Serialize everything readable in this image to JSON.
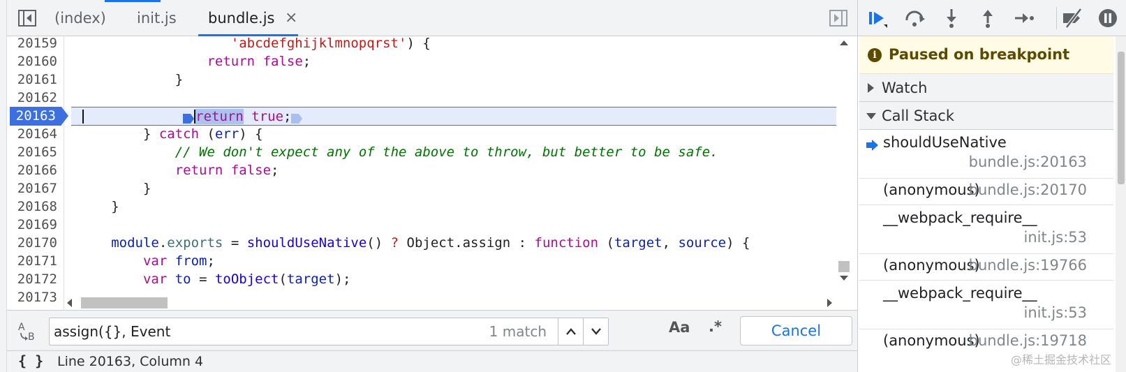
{
  "tabs": [
    {
      "label": "(index)"
    },
    {
      "label": "init.js"
    },
    {
      "label": "bundle.js",
      "close": "×"
    }
  ],
  "editor": {
    "lines": [
      {
        "num": "20159"
      },
      {
        "num": "20160"
      },
      {
        "num": "20161"
      },
      {
        "num": "20162"
      },
      {
        "num": "20163"
      },
      {
        "num": "20164"
      },
      {
        "num": "20165"
      },
      {
        "num": "20166"
      },
      {
        "num": "20167"
      },
      {
        "num": "20168"
      },
      {
        "num": "20169"
      },
      {
        "num": "20170"
      },
      {
        "num": "20171"
      },
      {
        "num": "20172"
      },
      {
        "num": "20173"
      }
    ],
    "code": {
      "l20159": {
        "str": "'abcdefghijklmnopqrst'",
        "rest": ") {"
      },
      "l20160": {
        "kw": "return",
        "val": "false",
        "semi": ";"
      },
      "l20161": {
        "brace": "}"
      },
      "l20163": {
        "kw": "return",
        "val": "true",
        "semi": ";"
      },
      "l20164": {
        "brace": "}",
        "kw": "catch",
        "open": " (",
        "var": "err",
        "close": ") {"
      },
      "l20165": {
        "comment": "// We don't expect any of the above to throw, but better to be safe."
      },
      "l20166": {
        "kw": "return",
        "val": "false",
        "semi": ";"
      },
      "l20167": {
        "brace": "}"
      },
      "l20168": {
        "brace": "}"
      },
      "l20170": {
        "obj": "module",
        "dot": ".",
        "prop": "exports",
        "eq": " = ",
        "fn": "shouldUseNative",
        "call": "() ",
        "q": "?",
        "mid": " Object.assign : ",
        "kw": "function",
        "args_open": " (",
        "a1": "target",
        "comma": ", ",
        "a2": "source",
        "args_close": ") {"
      },
      "l20171": {
        "kw": "var",
        "name": "from",
        "semi": ";"
      },
      "l20172": {
        "kw": "var",
        "name": "to",
        "eq": " = ",
        "fn": "toObject",
        "open": "(",
        "arg": "target",
        "close": ");"
      }
    }
  },
  "search": {
    "value": "assign({}, Event",
    "match_count": "1 match",
    "case_label": "Aa",
    "regex_label": ".*",
    "cancel_label": "Cancel"
  },
  "status": {
    "braces": "{ }",
    "text": "Line 20163, Column 4"
  },
  "debugger": {
    "paused_text": "Paused on breakpoint",
    "info_icon": "i",
    "watch_label": "Watch",
    "call_stack_label": "Call Stack",
    "frames": [
      {
        "name": "shouldUseNative",
        "loc": "bundle.js:20163",
        "current": true
      },
      {
        "name": "(anonymous)",
        "loc": "bundle.js:20170"
      },
      {
        "name": "__webpack_require__",
        "loc": "init.js:53"
      },
      {
        "name": "(anonymous)",
        "loc": "bundle.js:19766"
      },
      {
        "name": "__webpack_require__",
        "loc": "init.js:53"
      },
      {
        "name": "(anonymous)",
        "loc": "bundle.js:19718"
      }
    ]
  },
  "watermark": "@稀土掘金技术社区",
  "colors": {
    "accent": "#1a73e8",
    "breakpoint": "#3c6fe0",
    "paused_banner_bg": "#fffbe5",
    "keyword": "#aa0d91",
    "string": "#c41a16",
    "comment": "#007400"
  }
}
